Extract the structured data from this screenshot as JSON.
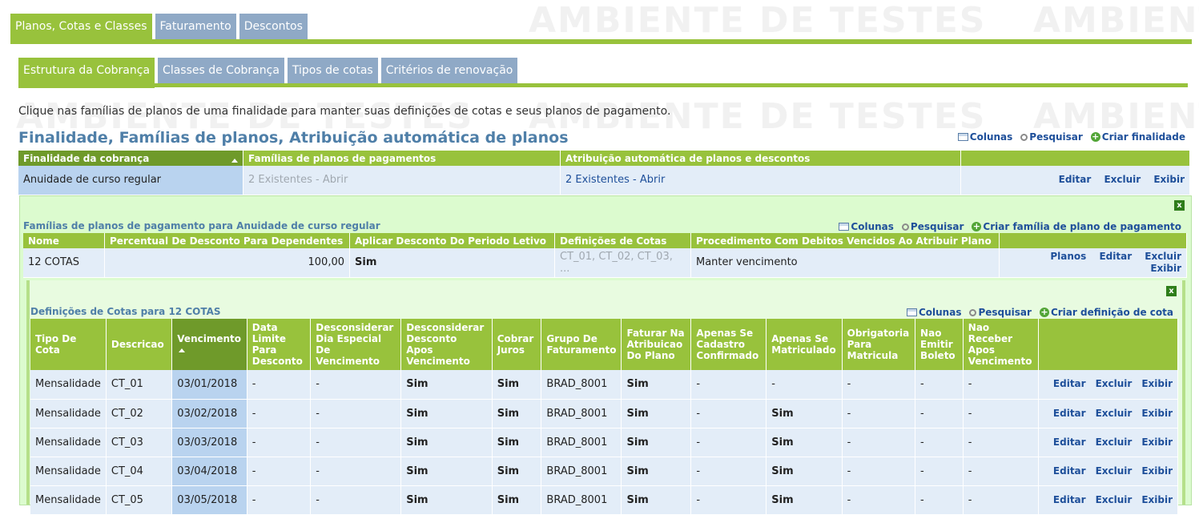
{
  "watermark": "AMBIENTE DE TESTES",
  "top_tabs": [
    "Planos, Cotas e Classes",
    "Faturamento",
    "Descontos"
  ],
  "sub_tabs": [
    "Estrutura da Cobrança",
    "Classes de Cobrança",
    "Tipos de cotas",
    "Critérios de renovação"
  ],
  "intro": "Clique nas famílias de planos de uma finalidade para manter suas definições de cotas e seus planos de pagamento.",
  "title": "Finalidade, Famílias de planos, Atribuição automática de planos",
  "toolbar_main": {
    "columns": "Colunas",
    "search": "Pesquisar",
    "create": "Criar finalidade"
  },
  "main_table": {
    "headers": [
      "Finalidade da cobrança",
      "Famílias de planos de pagamentos",
      "Atribuição automática de planos e descontos",
      ""
    ],
    "row": {
      "finalidade": "Anuidade de curso regular",
      "familias": "2 Existentes - Abrir",
      "atribuicao": "2 Existentes - Abrir"
    },
    "actions": [
      "Editar",
      "Excluir",
      "Exibir"
    ]
  },
  "families_panel": {
    "title": "Famílias de planos de pagamento para Anuidade de curso regular",
    "toolbar": {
      "columns": "Colunas",
      "search": "Pesquisar",
      "create": "Criar família de plano de pagamento"
    },
    "headers": [
      "Nome",
      "Percentual De Desconto Para Dependentes",
      "Aplicar Desconto Do Periodo Letivo",
      "Definições de Cotas",
      "Procedimento Com Debitos Vencidos Ao Atribuir Plano",
      ""
    ],
    "row": {
      "nome": "12 COTAS",
      "percentual": "100,00",
      "aplicar": "Sim",
      "definicoes": "CT_01, CT_02, CT_03, ...",
      "procedimento": "Manter vencimento"
    },
    "actions": [
      "Planos",
      "Editar",
      "Excluir",
      "Exibir"
    ]
  },
  "quotas_panel": {
    "title": "Definições de Cotas para 12 COTAS",
    "toolbar": {
      "columns": "Colunas",
      "search": "Pesquisar",
      "create": "Criar definição de cota"
    },
    "headers": [
      "Tipo De Cota",
      "Descricao",
      "Vencimento",
      "Data Limite Para Desconto",
      "Desconsiderar Dia Especial De Vencimento",
      "Desconsiderar Desconto Apos Vencimento",
      "Cobrar Juros",
      "Grupo De Faturamento",
      "Faturar Na Atribuicao Do Plano",
      "Apenas Se Cadastro Confirmado",
      "Apenas Se Matriculado",
      "Obrigatoria Para Matricula",
      "Nao Emitir Boleto",
      "Nao Receber Apos Vencimento",
      ""
    ],
    "rows": [
      [
        "Mensalidade",
        "CT_01",
        "03/01/2018",
        "-",
        "-",
        "Sim",
        "Sim",
        "BRAD_8001",
        "Sim",
        "-",
        "-",
        "-",
        "-",
        "-"
      ],
      [
        "Mensalidade",
        "CT_02",
        "03/02/2018",
        "-",
        "-",
        "Sim",
        "Sim",
        "BRAD_8001",
        "Sim",
        "-",
        "Sim",
        "-",
        "-",
        "-"
      ],
      [
        "Mensalidade",
        "CT_03",
        "03/03/2018",
        "-",
        "-",
        "Sim",
        "Sim",
        "BRAD_8001",
        "Sim",
        "-",
        "Sim",
        "-",
        "-",
        "-"
      ],
      [
        "Mensalidade",
        "CT_04",
        "03/04/2018",
        "-",
        "-",
        "Sim",
        "Sim",
        "BRAD_8001",
        "Sim",
        "-",
        "Sim",
        "-",
        "-",
        "-"
      ],
      [
        "Mensalidade",
        "CT_05",
        "03/05/2018",
        "-",
        "-",
        "Sim",
        "Sim",
        "BRAD_8001",
        "Sim",
        "-",
        "Sim",
        "-",
        "-",
        "-"
      ]
    ],
    "actions": [
      "Editar",
      "Excluir",
      "Exibir"
    ]
  }
}
